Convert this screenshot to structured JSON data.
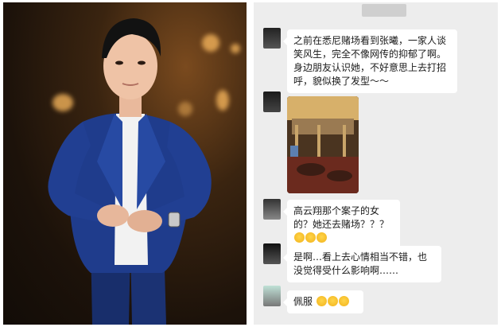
{
  "chat": {
    "messages": [
      {
        "text": "之前在悉尼赌场看到张曦，一家人谈笑风生，完全不像网传的抑郁了啊。身边朋友认识她，不好意思上去打招呼，貌似换了发型～～"
      },
      {
        "text": "高云翔那个案子的女的？她还去赌场？？？"
      },
      {
        "text": "是啊…看上去心情相当不错，也没觉得受什么影响啊……"
      },
      {
        "text": "佩服"
      }
    ]
  },
  "colors": {
    "chat_bg": "#ededed",
    "bubble_bg": "#ffffff",
    "suit_blue": "#1f3c8c"
  }
}
